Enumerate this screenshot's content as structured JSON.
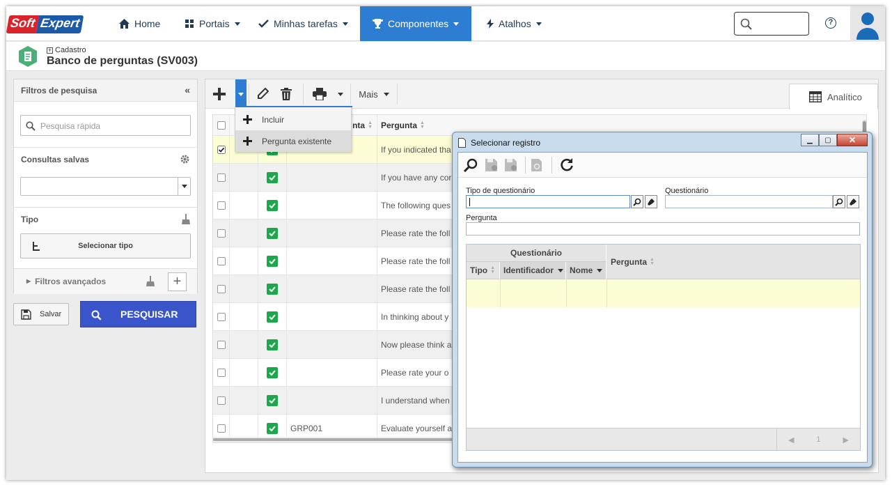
{
  "brand": {
    "logo_left": "Soft",
    "logo_right": "Expert"
  },
  "nav": [
    {
      "label": "Home",
      "icon": "home-icon"
    },
    {
      "label": "Portais",
      "icon": "grid-icon"
    },
    {
      "label": "Minhas tarefas",
      "icon": "check-icon"
    },
    {
      "label": "Componentes",
      "icon": "trophy-icon"
    },
    {
      "label": "Atalhos",
      "icon": "bolt-icon"
    }
  ],
  "breadcrumb": {
    "parent": "Cadastro",
    "title": "Banco de perguntas (SV003)"
  },
  "filters": {
    "title": "Filtros de pesquisa",
    "quick_search_placeholder": "Pesquisa rápida",
    "saved_queries_label": "Consultas salvas",
    "type_label": "Tipo",
    "select_type_button": "Selecionar tipo",
    "advanced_label": "Filtros avançados",
    "save_button": "Salvar",
    "search_button": "PESQUISAR"
  },
  "toolbar": {
    "more_label": "Mais",
    "view_tab": "Analítico"
  },
  "dropdown": {
    "items": [
      "Incluir",
      "Pergunta existente"
    ]
  },
  "table": {
    "headers": [
      "nta",
      "Pergunta"
    ],
    "rows": [
      {
        "code": "",
        "text": "If you indicated tha",
        "checked": true
      },
      {
        "code": "",
        "text": "If you have any cor",
        "checked": false
      },
      {
        "code": "",
        "text": "The following ques",
        "checked": false
      },
      {
        "code": "",
        "text": "Please rate the foll",
        "checked": false
      },
      {
        "code": "",
        "text": "Please rate the foll",
        "checked": false
      },
      {
        "code": "",
        "text": "Please rate the foll",
        "checked": false
      },
      {
        "code": "",
        "text": "In thinking about y",
        "checked": false
      },
      {
        "code": "",
        "text": "Now please think a",
        "checked": false
      },
      {
        "code": "",
        "text": "Please rate your o",
        "checked": false
      },
      {
        "code": "",
        "text": "I understand when",
        "checked": false
      },
      {
        "code": "GRP001",
        "text": "Evaluate yourself a",
        "checked": false
      }
    ]
  },
  "modal": {
    "title": "Selecionar registro",
    "field_type_label": "Tipo de questionário",
    "field_questionnaire_label": "Questionário",
    "field_question_label": "Pergunta",
    "grid_group_header": "Questionário",
    "grid_headers": {
      "tipo": "Tipo",
      "identificador": "Identificador",
      "nome": "Nome",
      "pergunta": "Pergunta"
    },
    "pager_page": "1"
  },
  "colors": {
    "accent": "#2d7dd2",
    "search_button": "#3a54c9",
    "check_green": "#1aa84b",
    "selected_row": "#fdfdd5"
  }
}
